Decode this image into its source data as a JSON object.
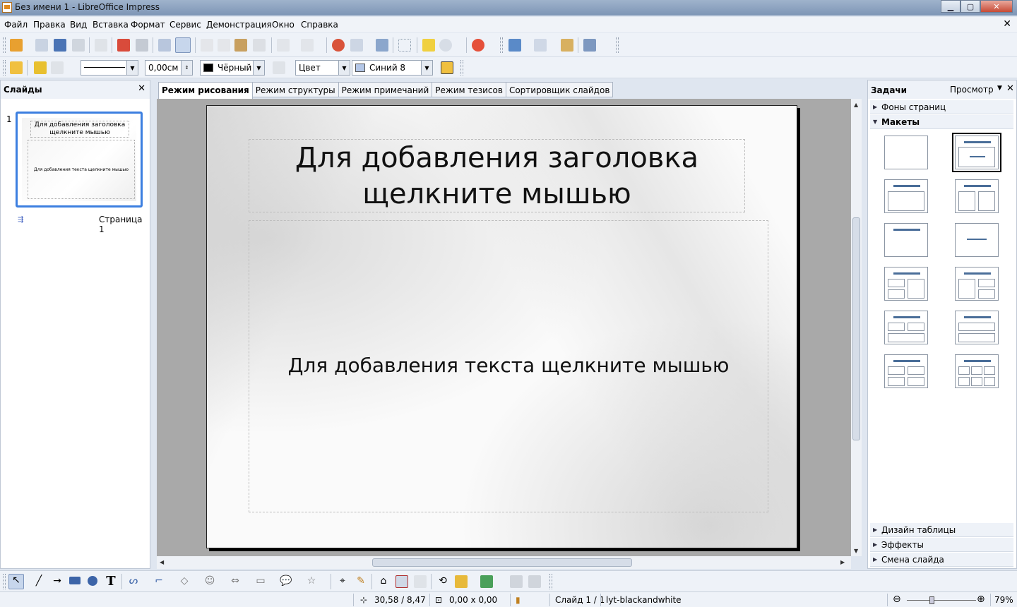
{
  "window": {
    "title": "Без имени 1 - LibreOffice Impress",
    "minimize": "▁",
    "maximize": "▢",
    "close": "✕"
  },
  "menu": [
    "Файл",
    "Правка",
    "Вид",
    "Вставка",
    "Формат",
    "Сервис",
    "Демонстрация",
    "Окно",
    "Справка"
  ],
  "toolbar2": {
    "line_width": "0,00см",
    "line_color": "Чёрный",
    "area_style": "Цвет",
    "area_color": "Синий 8",
    "colors": {
      "line": "#000000",
      "area": "#b4c7e7"
    }
  },
  "slides_pane": {
    "title": "Слайды",
    "slide_number": "1",
    "page_label": "Страница 1",
    "thumb_title": "Для добавления заголовка щелкните мышью",
    "thumb_body": "Для добавления текста щелкните мышью"
  },
  "view_tabs": [
    "Режим рисования",
    "Режим структуры",
    "Режим примечаний",
    "Режим тезисов",
    "Сортировщик слайдов"
  ],
  "slide": {
    "title_placeholder": "Для добавления заголовка щелкните мышью",
    "body_placeholder": "Для добавления текста щелкните мышью"
  },
  "tasks_pane": {
    "title": "Задачи",
    "view": "Просмотр",
    "sections": {
      "backgrounds": "Фоны страниц",
      "layouts": "Макеты",
      "table_design": "Дизайн таблицы",
      "effects": "Эффекты",
      "transition": "Смена слайда"
    }
  },
  "statusbar": {
    "position": "30,58 / 8,47",
    "size": "0,00 x 0,00",
    "slide": "Слайд 1 / 1",
    "master": "lyt-blackandwhite",
    "zoom": "79%"
  }
}
